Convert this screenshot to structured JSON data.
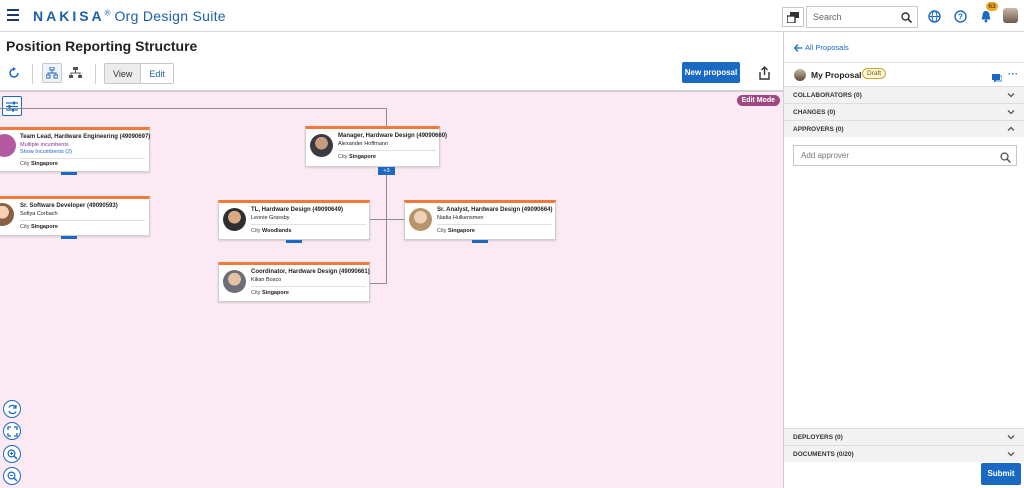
{
  "header": {
    "brand_name": "NAKISA",
    "brand_mark": "®",
    "brand_suite": "Org Design Suite",
    "search_placeholder": "Search",
    "notification_count": "63"
  },
  "page": {
    "title": "Position Reporting Structure",
    "view_label": "View",
    "edit_label": "Edit",
    "new_proposal_label": "New proposal",
    "edit_mode_label": "Edit Mode"
  },
  "cards": [
    {
      "title": "Team Lead, Hardware Engineering (49090697)",
      "line1": "Multiple incumbents",
      "line2": "Show Incumbents (2)",
      "city_label": "City",
      "city": "Singapore"
    },
    {
      "title": "Sr. Software Developer (49090593)",
      "name": "Sofiya Corbach",
      "city_label": "City",
      "city": "Singapore"
    },
    {
      "title": "Manager, Hardware Design (49090660)",
      "name": "Alexander Hoffmann",
      "city_label": "City",
      "city": "Singapore",
      "children_count": "3"
    },
    {
      "title": "TL, Hardware Design (49090649)",
      "name": "Leonie Grassby",
      "city_label": "City",
      "city": "Woodlands"
    },
    {
      "title": "Sr. Analyst, Hardware Design (49090664)",
      "name": "Nadia Hulkensmen",
      "city_label": "City",
      "city": "Singapore"
    },
    {
      "title": "Coordinator, Hardware Design (49090661)",
      "name": "Kilian Bosco",
      "city_label": "City",
      "city": "Singapore"
    }
  ],
  "panel": {
    "back_label": "All Proposals",
    "proposal_name": "My Proposal",
    "status": "Draft",
    "sections": {
      "collaborators": "COLLABORATORS (0)",
      "changes": "CHANGES (0)",
      "approvers": "APPROVERS (0)",
      "deployers": "DEPLOYERS (0)",
      "documents": "DOCUMENTS (0/20)"
    },
    "add_approver_placeholder": "Add approver",
    "submit_label": "Submit"
  },
  "colors": {
    "accent": "#1a69c3",
    "card_top": "#f07a3a",
    "canvas_bg": "#fbeaf4",
    "edit_mode": "#9e4781"
  }
}
